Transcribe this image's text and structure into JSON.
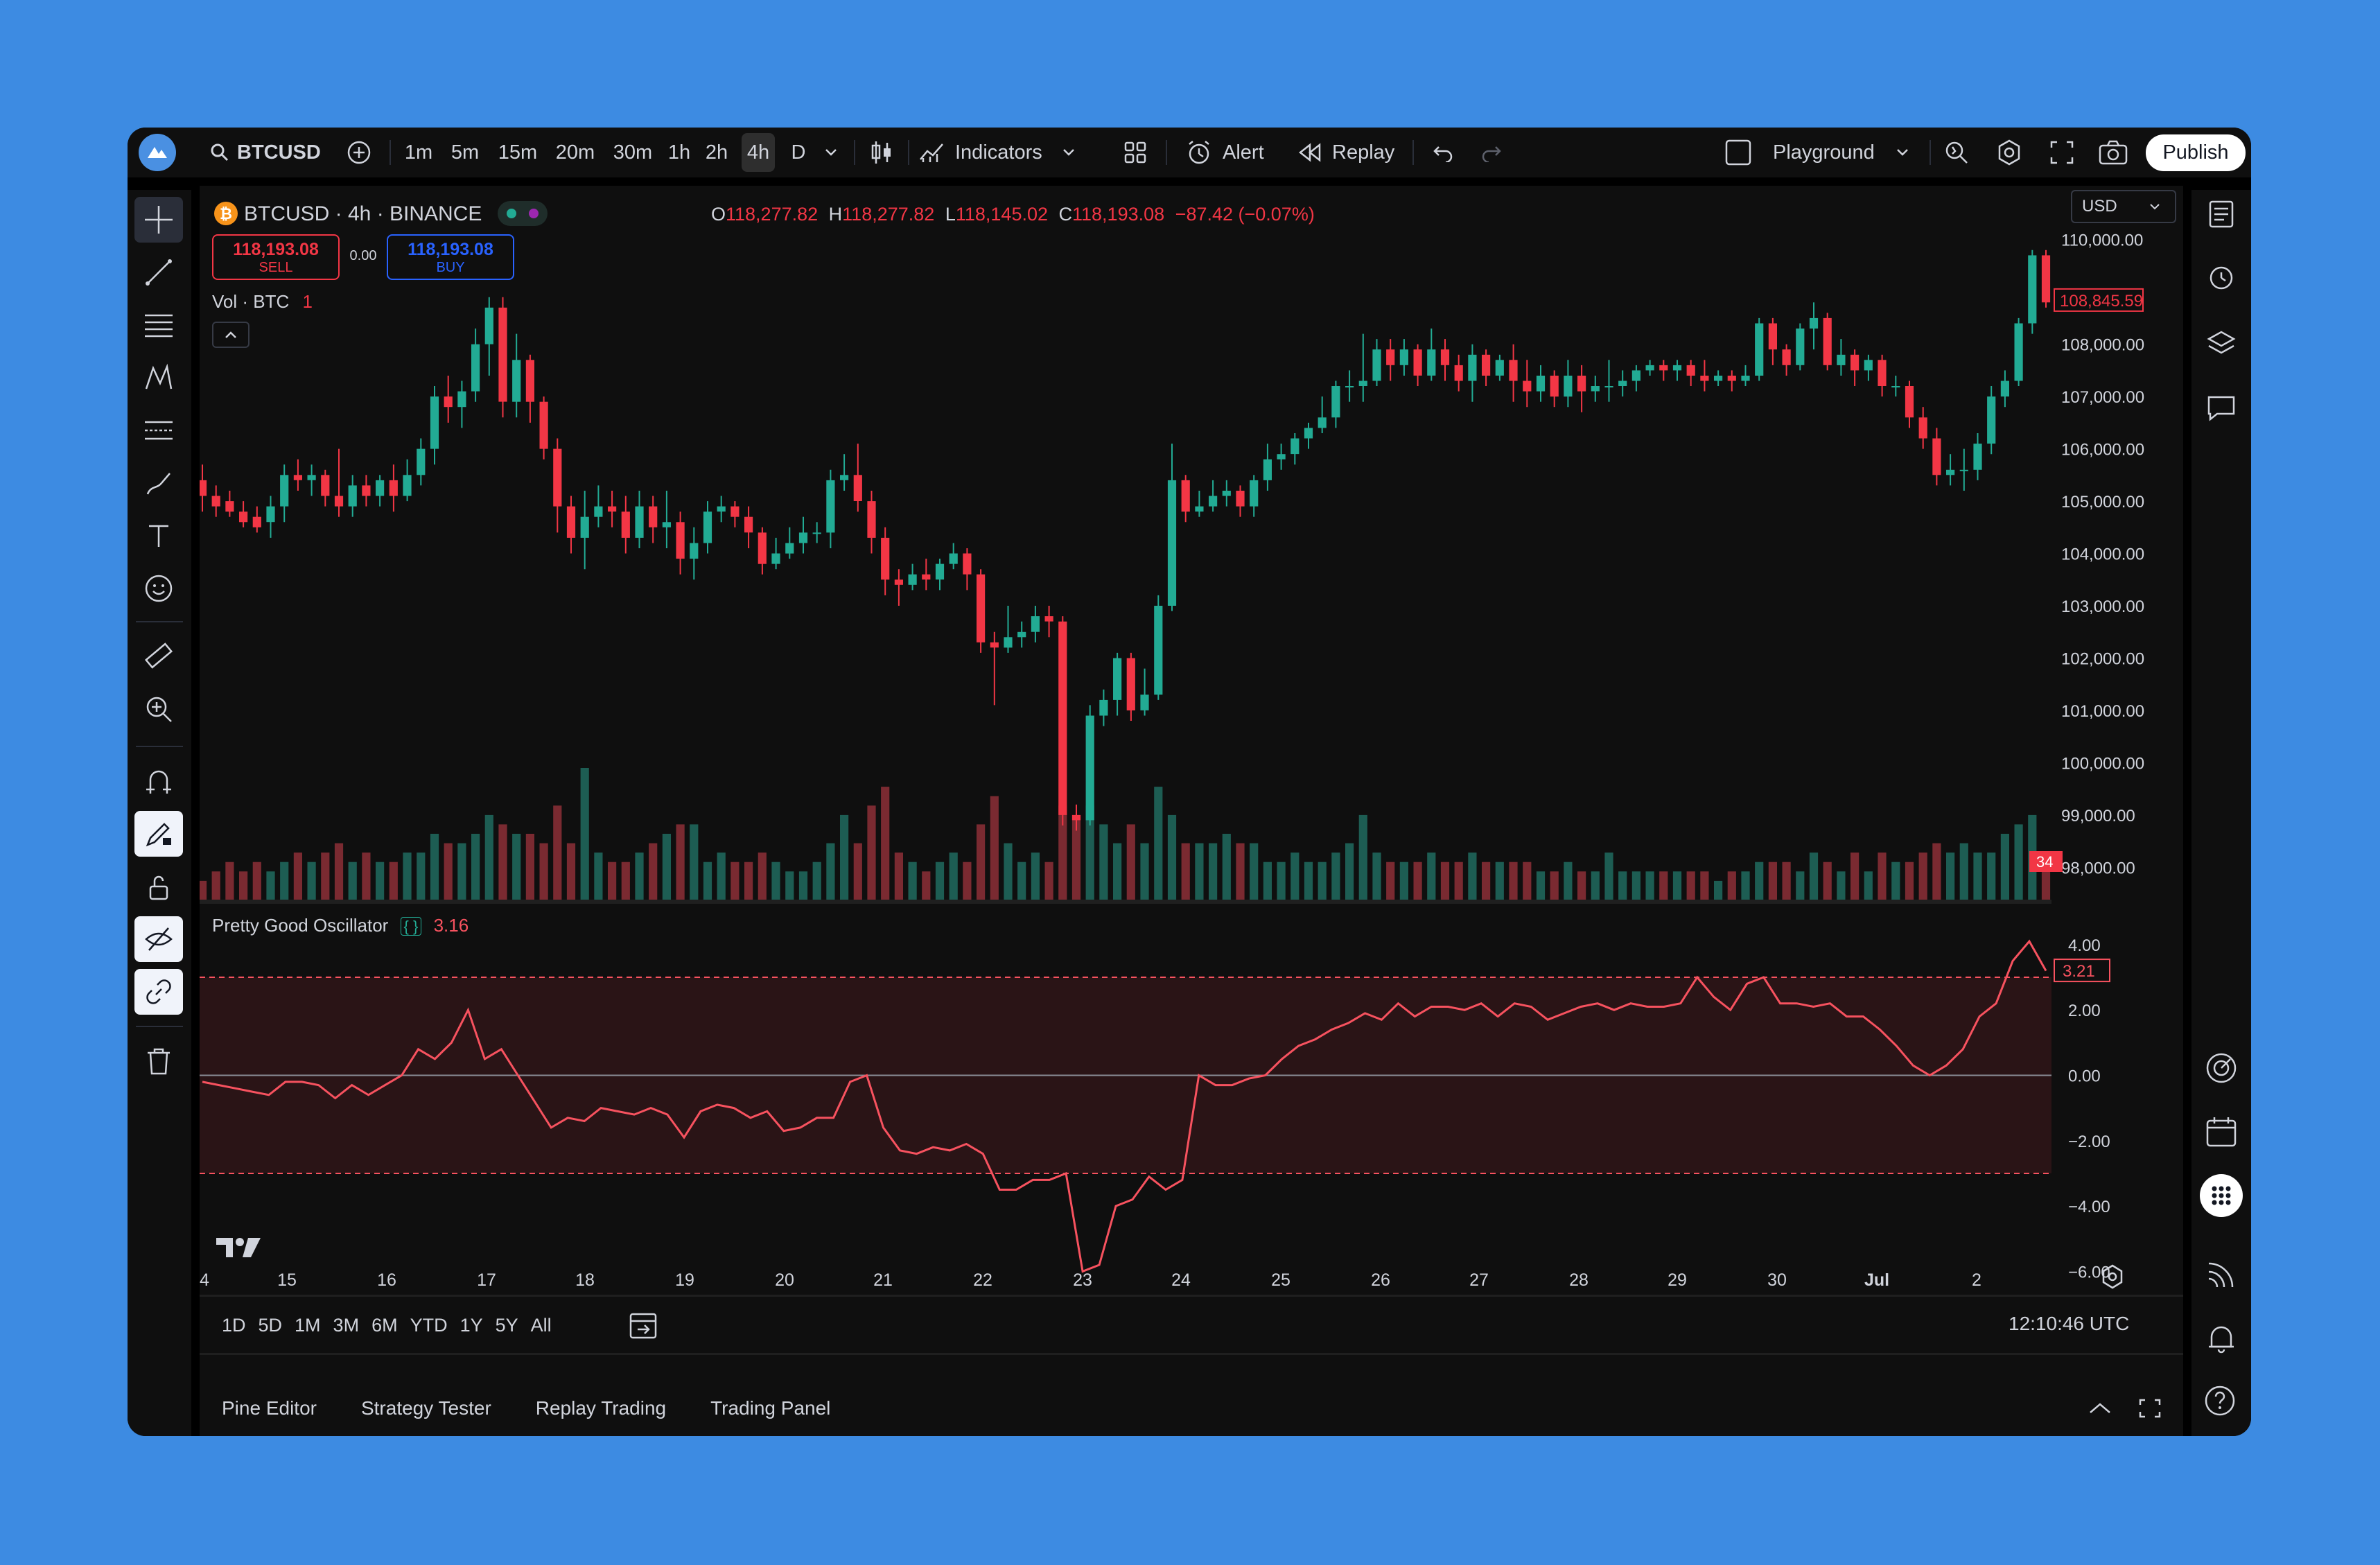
{
  "toolbar": {
    "symbol": "BTCUSD",
    "timeframes": [
      "1m",
      "5m",
      "15m",
      "20m",
      "30m",
      "1h",
      "2h",
      "4h",
      "D"
    ],
    "active_timeframe": "4h",
    "indicators_label": "Indicators",
    "alert_label": "Alert",
    "replay_label": "Replay",
    "layout_name": "Playground",
    "publish_label": "Publish"
  },
  "legend": {
    "title": "BTCUSD · 4h · BINANCE",
    "o_label": "O",
    "o_value": "118,277.82",
    "h_label": "H",
    "h_value": "118,277.82",
    "l_label": "L",
    "l_value": "118,145.02",
    "c_label": "C",
    "c_value": "118,193.08",
    "change": "−87.42 (−0.07%)",
    "sell_price": "118,193.08",
    "sell_label": "SELL",
    "spread": "0.00",
    "buy_price": "118,193.08",
    "buy_label": "BUY",
    "vol_label": "Vol · BTC",
    "vol_value": "1"
  },
  "price_axis": {
    "currency": "USD",
    "ticks": [
      "110,000.00",
      "108,000.00",
      "107,000.00",
      "106,000.00",
      "105,000.00",
      "104,000.00",
      "103,000.00",
      "102,000.00",
      "101,000.00",
      "100,000.00",
      "99,000.00",
      "98,000.00"
    ],
    "last_price": "108,845.59",
    "vol_badge": "34"
  },
  "oscillator": {
    "name": "Pretty Good Oscillator",
    "value": "3.16",
    "ticks": [
      "4.00",
      "2.00",
      "0.00",
      "−2.00",
      "−4.00",
      "−6.00"
    ],
    "last_value": "3.21"
  },
  "time_axis": {
    "labels": [
      "4",
      "15",
      "16",
      "17",
      "18",
      "19",
      "20",
      "21",
      "22",
      "23",
      "24",
      "25",
      "26",
      "27",
      "28",
      "29",
      "30",
      "Jul",
      "2"
    ]
  },
  "ranges": [
    "1D",
    "5D",
    "1M",
    "3M",
    "6M",
    "YTD",
    "1Y",
    "5Y",
    "All"
  ],
  "clock": "12:10:46 UTC",
  "bottom_tabs": [
    "Pine Editor",
    "Strategy Tester",
    "Replay Trading",
    "Trading Panel"
  ],
  "colors": {
    "up": "#22ab94",
    "down": "#f23645",
    "osc_line": "#f7525f",
    "osc_band": "#2a1416",
    "background": "#0f0f0f"
  },
  "chart_data": {
    "type": "candlestick",
    "price_range": [
      97700,
      110500
    ],
    "osc_range": [
      -6.5,
      4.4
    ],
    "osc_band": [
      -3,
      3
    ],
    "candles": [
      [
        105400,
        105100,
        105700,
        104800,
        2
      ],
      [
        105100,
        104900,
        105300,
        104700,
        3
      ],
      [
        105000,
        104800,
        105200,
        104700,
        4
      ],
      [
        104800,
        104600,
        105000,
        104500,
        3
      ],
      [
        104700,
        104500,
        104900,
        104400,
        4
      ],
      [
        104600,
        104900,
        105100,
        104300,
        3
      ],
      [
        104900,
        105500,
        105700,
        104600,
        4
      ],
      [
        105500,
        105400,
        105800,
        105200,
        5
      ],
      [
        105400,
        105500,
        105700,
        105100,
        4
      ],
      [
        105500,
        105100,
        105600,
        104900,
        5
      ],
      [
        105100,
        104900,
        106000,
        104700,
        6
      ],
      [
        104900,
        105300,
        105500,
        104700,
        4
      ],
      [
        105300,
        105100,
        105500,
        104900,
        5
      ],
      [
        105100,
        105400,
        105500,
        104900,
        4
      ],
      [
        105400,
        105100,
        105700,
        104800,
        4
      ],
      [
        105100,
        105500,
        105800,
        105000,
        5
      ],
      [
        105500,
        106000,
        106200,
        105300,
        5
      ],
      [
        106000,
        107000,
        107200,
        105700,
        7
      ],
      [
        107000,
        106800,
        107400,
        106500,
        6
      ],
      [
        106800,
        107100,
        107300,
        106400,
        6
      ],
      [
        107100,
        108000,
        108300,
        106900,
        7
      ],
      [
        108000,
        108700,
        108900,
        107400,
        9
      ],
      [
        108700,
        106900,
        108900,
        106600,
        8
      ],
      [
        106900,
        107700,
        108200,
        106600,
        7
      ],
      [
        107700,
        106900,
        107800,
        106500,
        7
      ],
      [
        106900,
        106000,
        107000,
        105800,
        6
      ],
      [
        106000,
        104900,
        106200,
        104400,
        10
      ],
      [
        104900,
        104300,
        105100,
        104000,
        6
      ],
      [
        104300,
        104700,
        105200,
        103700,
        14
      ],
      [
        104700,
        104900,
        105300,
        104500,
        5
      ],
      [
        104900,
        104800,
        105200,
        104500,
        4
      ],
      [
        104800,
        104300,
        105100,
        104000,
        4
      ],
      [
        104300,
        104900,
        105200,
        104100,
        5
      ],
      [
        104900,
        104500,
        105100,
        104200,
        6
      ],
      [
        104500,
        104600,
        105200,
        104100,
        7
      ],
      [
        104600,
        103900,
        104800,
        103600,
        8
      ],
      [
        103900,
        104200,
        104500,
        103500,
        8
      ],
      [
        104200,
        104800,
        105000,
        104000,
        4
      ],
      [
        104800,
        104900,
        105100,
        104600,
        5
      ],
      [
        104900,
        104700,
        105000,
        104500,
        4
      ],
      [
        104700,
        104400,
        104900,
        104100,
        4
      ],
      [
        104400,
        103800,
        104500,
        103600,
        5
      ],
      [
        103800,
        104000,
        104300,
        103700,
        4
      ],
      [
        104000,
        104200,
        104500,
        103900,
        3
      ],
      [
        104200,
        104400,
        104700,
        104000,
        3
      ],
      [
        104400,
        104400,
        104600,
        104200,
        4
      ],
      [
        104400,
        105400,
        105600,
        104100,
        6
      ],
      [
        105400,
        105500,
        105900,
        105200,
        9
      ],
      [
        105500,
        105000,
        106100,
        104800,
        6
      ],
      [
        105000,
        104300,
        105200,
        104000,
        10
      ],
      [
        104300,
        103500,
        104500,
        103200,
        12
      ],
      [
        103500,
        103400,
        103700,
        103000,
        5
      ],
      [
        103400,
        103600,
        103800,
        103300,
        4
      ],
      [
        103600,
        103500,
        103900,
        103300,
        3
      ],
      [
        103500,
        103800,
        103900,
        103300,
        4
      ],
      [
        103800,
        104000,
        104200,
        103700,
        5
      ],
      [
        104000,
        103600,
        104100,
        103300,
        4
      ],
      [
        103600,
        102300,
        103700,
        102100,
        8
      ],
      [
        102300,
        102200,
        102500,
        101100,
        11
      ],
      [
        102200,
        102400,
        103000,
        102100,
        6
      ],
      [
        102400,
        102500,
        102700,
        102200,
        4
      ],
      [
        102500,
        102800,
        103000,
        102300,
        5
      ],
      [
        102800,
        102700,
        103000,
        102400,
        4
      ],
      [
        102700,
        99000,
        102800,
        98800,
        10
      ],
      [
        99000,
        98900,
        99200,
        98700,
        9
      ],
      [
        98900,
        100900,
        101100,
        98800,
        10
      ],
      [
        100900,
        101200,
        101400,
        100700,
        8
      ],
      [
        101200,
        102000,
        102100,
        100900,
        6
      ],
      [
        102000,
        101000,
        102100,
        100800,
        8
      ],
      [
        101000,
        101300,
        101800,
        100900,
        6
      ],
      [
        101300,
        103000,
        103200,
        101200,
        12
      ],
      [
        103000,
        105400,
        106100,
        102900,
        9
      ],
      [
        105400,
        104800,
        105500,
        104600,
        6
      ],
      [
        104800,
        104900,
        105200,
        104700,
        6
      ],
      [
        104900,
        105100,
        105400,
        104800,
        6
      ],
      [
        105100,
        105200,
        105400,
        104900,
        7
      ],
      [
        105200,
        104900,
        105300,
        104700,
        6
      ],
      [
        104900,
        105400,
        105500,
        104700,
        6
      ],
      [
        105400,
        105800,
        106100,
        105200,
        4
      ],
      [
        105800,
        105900,
        106100,
        105600,
        4
      ],
      [
        105900,
        106200,
        106300,
        105700,
        5
      ],
      [
        106200,
        106400,
        106500,
        106000,
        4
      ],
      [
        106400,
        106600,
        107000,
        106300,
        4
      ],
      [
        106600,
        107200,
        107300,
        106400,
        5
      ],
      [
        107200,
        107200,
        107500,
        106900,
        6
      ],
      [
        107200,
        107300,
        108200,
        106900,
        9
      ],
      [
        107300,
        107900,
        108100,
        107200,
        5
      ],
      [
        107900,
        107600,
        108100,
        107300,
        4
      ],
      [
        107600,
        107900,
        108100,
        107400,
        4
      ],
      [
        107900,
        107400,
        108000,
        107200,
        4
      ],
      [
        107400,
        107900,
        108300,
        107300,
        5
      ],
      [
        107900,
        107600,
        108100,
        107300,
        4
      ],
      [
        107600,
        107300,
        107800,
        107100,
        4
      ],
      [
        107300,
        107800,
        108000,
        106900,
        5
      ],
      [
        107800,
        107400,
        107900,
        107200,
        4
      ],
      [
        107400,
        107700,
        107800,
        107300,
        4
      ],
      [
        107700,
        107300,
        108000,
        106900,
        4
      ],
      [
        107300,
        107100,
        107700,
        106800,
        4
      ],
      [
        107100,
        107400,
        107600,
        106900,
        3
      ],
      [
        107400,
        107000,
        107500,
        106800,
        3
      ],
      [
        107000,
        107400,
        107700,
        106800,
        4
      ],
      [
        107400,
        107100,
        107600,
        106700,
        3
      ],
      [
        107100,
        107200,
        107400,
        106900,
        3
      ],
      [
        107200,
        107200,
        107700,
        106900,
        5
      ],
      [
        107200,
        107300,
        107500,
        107000,
        3
      ],
      [
        107300,
        107500,
        107600,
        107100,
        3
      ],
      [
        107500,
        107600,
        107700,
        107400,
        3
      ],
      [
        107600,
        107500,
        107700,
        107300,
        3
      ],
      [
        107500,
        107600,
        107700,
        107300,
        3
      ],
      [
        107600,
        107400,
        107700,
        107200,
        3
      ],
      [
        107400,
        107300,
        107700,
        107100,
        3
      ],
      [
        107300,
        107400,
        107500,
        107200,
        2
      ],
      [
        107400,
        107300,
        107500,
        107100,
        3
      ],
      [
        107300,
        107400,
        107600,
        107200,
        3
      ],
      [
        107400,
        108400,
        108500,
        107300,
        4
      ],
      [
        108400,
        107900,
        108500,
        107600,
        4
      ],
      [
        107900,
        107600,
        108000,
        107400,
        4
      ],
      [
        107600,
        108300,
        108400,
        107500,
        3
      ],
      [
        108300,
        108500,
        108800,
        107900,
        5
      ],
      [
        108500,
        107600,
        108600,
        107500,
        4
      ],
      [
        107600,
        107800,
        108100,
        107400,
        3
      ],
      [
        107800,
        107500,
        107900,
        107200,
        5
      ],
      [
        107500,
        107700,
        107800,
        107300,
        3
      ],
      [
        107700,
        107200,
        107800,
        107000,
        5
      ],
      [
        107200,
        107200,
        107400,
        107000,
        4
      ],
      [
        107200,
        106600,
        107300,
        106400,
        4
      ],
      [
        106600,
        106200,
        106800,
        106000,
        5
      ],
      [
        106200,
        105500,
        106400,
        105300,
        6
      ],
      [
        105500,
        105600,
        105900,
        105300,
        5
      ],
      [
        105600,
        105600,
        106000,
        105200,
        6
      ],
      [
        105600,
        106100,
        106300,
        105400,
        5
      ],
      [
        106100,
        107000,
        107200,
        105900,
        5
      ],
      [
        107000,
        107300,
        107500,
        106800,
        7
      ],
      [
        107300,
        108400,
        108500,
        107200,
        8
      ],
      [
        108400,
        109700,
        109800,
        108200,
        9
      ],
      [
        109700,
        108800,
        109800,
        108700,
        4
      ]
    ],
    "oscillator": [
      -0.2,
      -0.3,
      -0.4,
      -0.5,
      -0.6,
      -0.2,
      -0.2,
      -0.3,
      -0.7,
      -0.3,
      -0.6,
      -0.3,
      0.0,
      0.8,
      0.5,
      1.0,
      2.0,
      0.5,
      0.8,
      0.0,
      -0.8,
      -1.6,
      -1.3,
      -1.4,
      -1.0,
      -1.1,
      -1.2,
      -1.0,
      -1.2,
      -1.9,
      -1.1,
      -0.9,
      -1.0,
      -1.3,
      -1.1,
      -1.7,
      -1.6,
      -1.3,
      -1.3,
      -0.2,
      0.0,
      -1.6,
      -2.3,
      -2.4,
      -2.2,
      -2.3,
      -2.1,
      -2.4,
      -3.5,
      -3.5,
      -3.2,
      -3.2,
      -3.0,
      -6.0,
      -5.8,
      -4.0,
      -3.8,
      -3.1,
      -3.5,
      -3.2,
      0.0,
      -0.3,
      -0.3,
      -0.1,
      0.0,
      0.5,
      0.9,
      1.1,
      1.4,
      1.6,
      1.9,
      1.7,
      2.2,
      1.8,
      2.1,
      2.1,
      2.0,
      2.2,
      1.8,
      2.2,
      2.1,
      1.7,
      1.9,
      2.1,
      2.2,
      2.0,
      2.2,
      2.1,
      2.1,
      2.2,
      3.0,
      2.4,
      2.0,
      2.8,
      3.0,
      2.2,
      2.2,
      2.1,
      2.2,
      1.8,
      1.8,
      1.4,
      0.9,
      0.3,
      0.0,
      0.3,
      0.8,
      1.8,
      2.2,
      3.5,
      4.1,
      3.2
    ]
  }
}
